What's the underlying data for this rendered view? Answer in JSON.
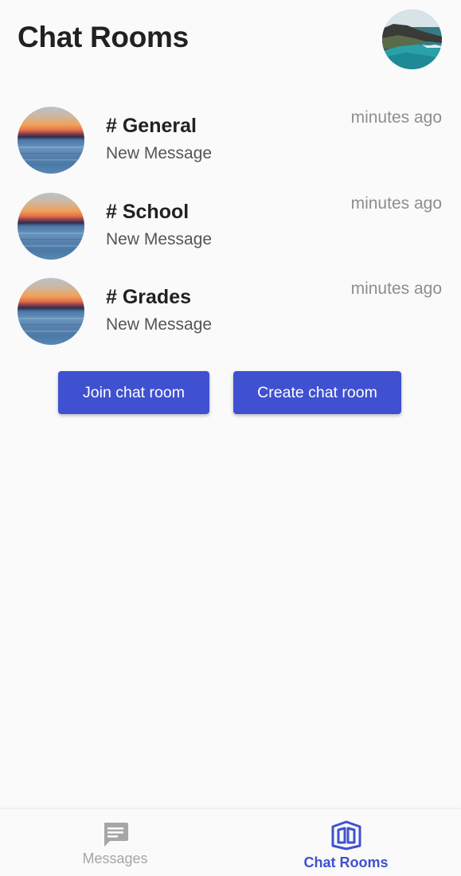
{
  "header": {
    "title": "Chat Rooms",
    "profile_avatar": "profile-photo"
  },
  "rooms": [
    {
      "name": "# General",
      "last_message": "New Message",
      "time": "minutes ago"
    },
    {
      "name": "# School",
      "last_message": "New Message",
      "time": "minutes ago"
    },
    {
      "name": "# Grades",
      "last_message": "New Message",
      "time": "minutes ago"
    }
  ],
  "actions": {
    "join_label": "Join chat room",
    "create_label": "Create chat room"
  },
  "bottom_nav": {
    "items": [
      {
        "label": "Messages",
        "icon": "message-icon",
        "active": false
      },
      {
        "label": "Chat Rooms",
        "icon": "chat-rooms-icon",
        "active": true
      }
    ]
  },
  "colors": {
    "accent": "#3f51d0",
    "background": "#fafafa",
    "inactive": "#a6a6a6",
    "timestamp": "#8e8e8e"
  }
}
